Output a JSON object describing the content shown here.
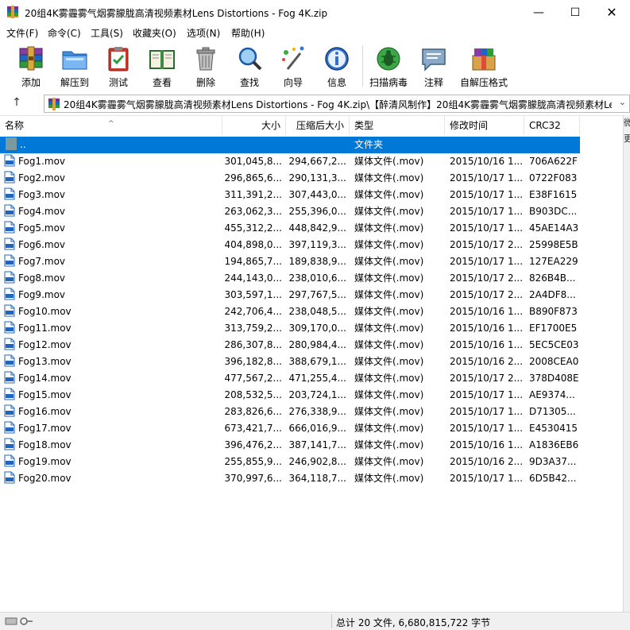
{
  "window": {
    "title": "20组4K雾霾雾气烟雾朦胧高清视频素材Lens Distortions - Fog 4K.zip",
    "minimize_glyph": "—",
    "maximize_glyph": "☐",
    "close_glyph": "✕"
  },
  "menu": [
    "文件(F)",
    "命令(C)",
    "工具(S)",
    "收藏夹(O)",
    "选项(N)",
    "帮助(H)"
  ],
  "toolbar": {
    "add": "添加",
    "extract": "解压到",
    "test": "测试",
    "view": "查看",
    "delete": "删除",
    "find": "查找",
    "wizard": "向导",
    "info": "信息",
    "virus_scan": "扫描病毒",
    "comment": "注释",
    "sfx": "自解压格式"
  },
  "address": {
    "up_glyph": "↑",
    "path": "20组4K雾霾雾气烟雾朦胧高清视频素材Lens Distortions - Fog 4K.zip\\【醉清风制作】20组4K雾霾雾气烟雾朦胧高清视频素材Lens",
    "dropdown_glyph": "⌄"
  },
  "columns": {
    "name": "名称",
    "size": "大小",
    "packed": "压缩后大小",
    "type": "类型",
    "modified": "修改时间",
    "crc": "CRC32",
    "sort_glyph": "^"
  },
  "parent_row": {
    "name": "..",
    "type": "文件夹"
  },
  "files": [
    {
      "name": "Fog1.mov",
      "size": "301,045,8...",
      "packed": "294,667,2...",
      "type": "媒体文件(.mov)",
      "modified": "2015/10/16 1...",
      "crc": "706A622F"
    },
    {
      "name": "Fog2.mov",
      "size": "296,865,6...",
      "packed": "290,131,3...",
      "type": "媒体文件(.mov)",
      "modified": "2015/10/17 1...",
      "crc": "0722F083"
    },
    {
      "name": "Fog3.mov",
      "size": "311,391,2...",
      "packed": "307,443,0...",
      "type": "媒体文件(.mov)",
      "modified": "2015/10/17 1...",
      "crc": "E38F1615"
    },
    {
      "name": "Fog4.mov",
      "size": "263,062,3...",
      "packed": "255,396,0...",
      "type": "媒体文件(.mov)",
      "modified": "2015/10/17 1...",
      "crc": "B903DC..."
    },
    {
      "name": "Fog5.mov",
      "size": "455,312,2...",
      "packed": "448,842,9...",
      "type": "媒体文件(.mov)",
      "modified": "2015/10/17 1...",
      "crc": "45AE14A3"
    },
    {
      "name": "Fog6.mov",
      "size": "404,898,0...",
      "packed": "397,119,3...",
      "type": "媒体文件(.mov)",
      "modified": "2015/10/17 2...",
      "crc": "25998E5B"
    },
    {
      "name": "Fog7.mov",
      "size": "194,865,7...",
      "packed": "189,838,9...",
      "type": "媒体文件(.mov)",
      "modified": "2015/10/17 1...",
      "crc": "127EA229"
    },
    {
      "name": "Fog8.mov",
      "size": "244,143,0...",
      "packed": "238,010,6...",
      "type": "媒体文件(.mov)",
      "modified": "2015/10/17 2...",
      "crc": "826B4B..."
    },
    {
      "name": "Fog9.mov",
      "size": "303,597,1...",
      "packed": "297,767,5...",
      "type": "媒体文件(.mov)",
      "modified": "2015/10/17 2...",
      "crc": "2A4DF8..."
    },
    {
      "name": "Fog10.mov",
      "size": "242,706,4...",
      "packed": "238,048,5...",
      "type": "媒体文件(.mov)",
      "modified": "2015/10/16 1...",
      "crc": "B890F873"
    },
    {
      "name": "Fog11.mov",
      "size": "313,759,2...",
      "packed": "309,170,0...",
      "type": "媒体文件(.mov)",
      "modified": "2015/10/16 1...",
      "crc": "EF1700E5"
    },
    {
      "name": "Fog12.mov",
      "size": "286,307,8...",
      "packed": "280,984,4...",
      "type": "媒体文件(.mov)",
      "modified": "2015/10/16 1...",
      "crc": "5EC5CE03"
    },
    {
      "name": "Fog13.mov",
      "size": "396,182,8...",
      "packed": "388,679,1...",
      "type": "媒体文件(.mov)",
      "modified": "2015/10/16 2...",
      "crc": "2008CEA0"
    },
    {
      "name": "Fog14.mov",
      "size": "477,567,2...",
      "packed": "471,255,4...",
      "type": "媒体文件(.mov)",
      "modified": "2015/10/17 2...",
      "crc": "378D408E"
    },
    {
      "name": "Fog15.mov",
      "size": "208,532,5...",
      "packed": "203,724,1...",
      "type": "媒体文件(.mov)",
      "modified": "2015/10/17 1...",
      "crc": "AE9374..."
    },
    {
      "name": "Fog16.mov",
      "size": "283,826,6...",
      "packed": "276,338,9...",
      "type": "媒体文件(.mov)",
      "modified": "2015/10/17 1...",
      "crc": "D71305..."
    },
    {
      "name": "Fog17.mov",
      "size": "673,421,7...",
      "packed": "666,016,9...",
      "type": "媒体文件(.mov)",
      "modified": "2015/10/17 1...",
      "crc": "E4530415"
    },
    {
      "name": "Fog18.mov",
      "size": "396,476,2...",
      "packed": "387,141,7...",
      "type": "媒体文件(.mov)",
      "modified": "2015/10/16 1...",
      "crc": "A1836EB6"
    },
    {
      "name": "Fog19.mov",
      "size": "255,855,9...",
      "packed": "246,902,8...",
      "type": "媒体文件(.mov)",
      "modified": "2015/10/16 2...",
      "crc": "9D3A37..."
    },
    {
      "name": "Fog20.mov",
      "size": "370,997,6...",
      "packed": "364,118,7...",
      "type": "媒体文件(.mov)",
      "modified": "2015/10/17 1...",
      "crc": "6D5B42..."
    }
  ],
  "side_panel": [
    "微",
    "更"
  ],
  "status": {
    "summary": "总计 20 文件, 6,680,815,722 字节"
  },
  "colors": {
    "selection": "#0078d7",
    "status_bg": "#f0f0f0"
  }
}
